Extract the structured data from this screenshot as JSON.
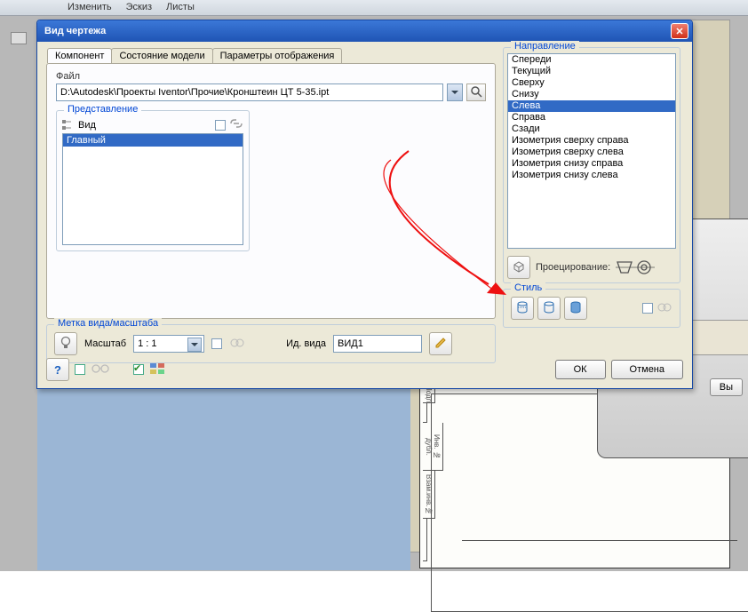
{
  "menu": {
    "items": [
      "Изменить",
      "Эскиз",
      "Листы"
    ]
  },
  "btn_vy": "Вы",
  "dialog": {
    "title": "Вид чертежа",
    "tabs": [
      "Компонент",
      "Состояние модели",
      "Параметры отображения"
    ],
    "file_label": "Файл",
    "file_path": "D:\\Autodesk\\Проекты Iventor\\Прочие\\Кронштеин ЦТ 5-35.ipt",
    "repr_legend": "Представление",
    "view_hdr": "Вид",
    "view_items": [
      "Главный"
    ],
    "scale_legend": "Метка вида/масштаба",
    "scale_label": "Масштаб",
    "scale_value": "1 : 1",
    "id_label": "Ид. вида",
    "id_value": "ВИД1",
    "direction_legend": "Направление",
    "directions": [
      "Спереди",
      "Текущий",
      "Сверху",
      "Снизу",
      "Слева",
      "Справа",
      "Сзади",
      "Изометрия сверху справа",
      "Изометрия сверху слева",
      "Изометрия снизу справа",
      "Изометрия снизу слева"
    ],
    "direction_selected_index": 4,
    "proj_label": "Проецирование:",
    "style_legend": "Стиль",
    "ok": "ОК",
    "cancel": "Отмена"
  },
  "stamp_rows": [
    "Подп",
    "",
    "Инв. № дубл.",
    "Взам.инв.№",
    ""
  ]
}
